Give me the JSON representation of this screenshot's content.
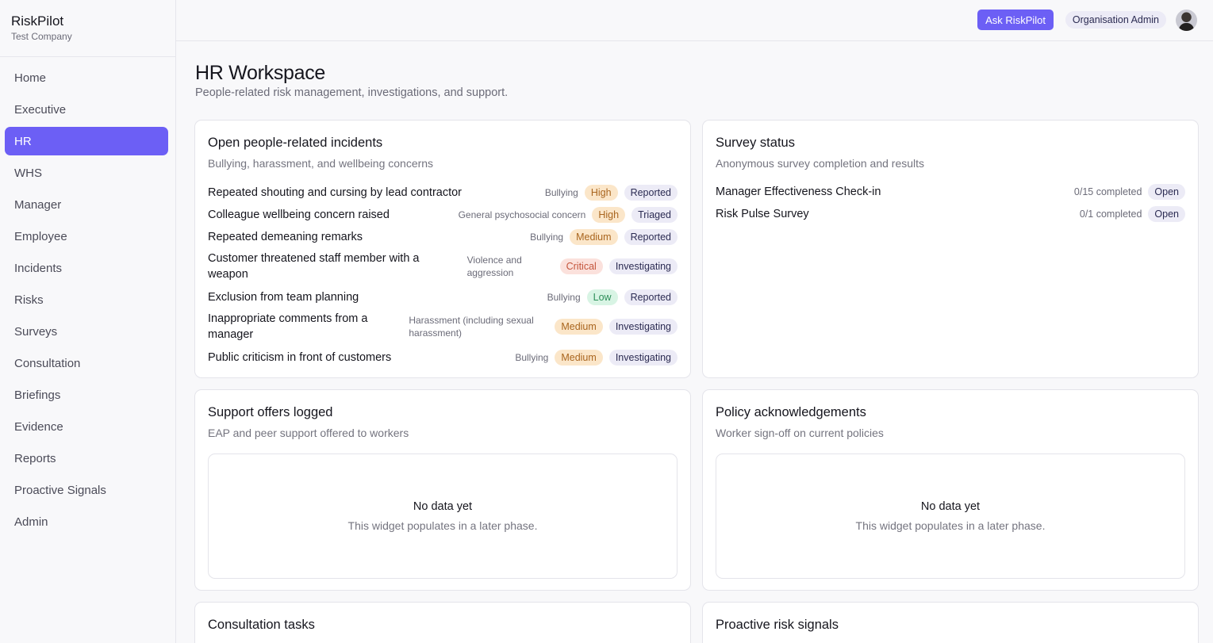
{
  "brand": {
    "name": "RiskPilot",
    "company": "Test Company"
  },
  "nav": {
    "items": [
      {
        "label": "Home"
      },
      {
        "label": "Executive"
      },
      {
        "label": "HR"
      },
      {
        "label": "WHS"
      },
      {
        "label": "Manager"
      },
      {
        "label": "Employee"
      },
      {
        "label": "Incidents"
      },
      {
        "label": "Risks"
      },
      {
        "label": "Surveys"
      },
      {
        "label": "Consultation"
      },
      {
        "label": "Briefings"
      },
      {
        "label": "Evidence"
      },
      {
        "label": "Reports"
      },
      {
        "label": "Proactive Signals"
      },
      {
        "label": "Admin"
      }
    ],
    "active": "HR"
  },
  "topbar": {
    "ask_label": "Ask RiskPilot",
    "role_label": "Organisation Admin"
  },
  "page": {
    "title": "HR Workspace",
    "subtitle": "People-related risk management, investigations, and support."
  },
  "incidents": {
    "title": "Open people-related incidents",
    "subtitle": "Bullying, harassment, and wellbeing concerns",
    "rows": [
      {
        "title": "Repeated shouting and cursing by lead contractor",
        "category": "Bullying",
        "severity": "High",
        "status": "Reported"
      },
      {
        "title": "Colleague wellbeing concern raised",
        "category": "General psychosocial concern",
        "severity": "High",
        "status": "Triaged"
      },
      {
        "title": "Repeated demeaning remarks",
        "category": "Bullying",
        "severity": "Medium",
        "status": "Reported"
      },
      {
        "title": "Customer threatened staff member with a weapon",
        "category": "Violence and aggression",
        "severity": "Critical",
        "status": "Investigating"
      },
      {
        "title": "Exclusion from team planning",
        "category": "Bullying",
        "severity": "Low",
        "status": "Reported"
      },
      {
        "title": "Inappropriate comments from a manager",
        "category": "Harassment (including sexual harassment)",
        "severity": "Medium",
        "status": "Investigating"
      },
      {
        "title": "Public criticism in front of customers",
        "category": "Bullying",
        "severity": "Medium",
        "status": "Investigating"
      }
    ]
  },
  "surveys": {
    "title": "Survey status",
    "subtitle": "Anonymous survey completion and results",
    "rows": [
      {
        "name": "Manager Effectiveness Check-in",
        "count": "0/15 completed",
        "status": "Open"
      },
      {
        "name": "Risk Pulse Survey",
        "count": "0/1 completed",
        "status": "Open"
      }
    ]
  },
  "support": {
    "title": "Support offers logged",
    "subtitle": "EAP and peer support offered to workers",
    "empty_title": "No data yet",
    "empty_text": "This widget populates in a later phase."
  },
  "policy": {
    "title": "Policy acknowledgements",
    "subtitle": "Worker sign-off on current policies",
    "empty_title": "No data yet",
    "empty_text": "This widget populates in a later phase."
  },
  "consultation": {
    "title": "Consultation tasks"
  },
  "signals": {
    "title": "Proactive risk signals"
  },
  "colors": {
    "accent": "#6c5ff5",
    "severity_high": "#a9651e",
    "severity_low": "#2e8f5a",
    "severity_critical": "#c4553c",
    "status_chip": "#ecebf6"
  }
}
